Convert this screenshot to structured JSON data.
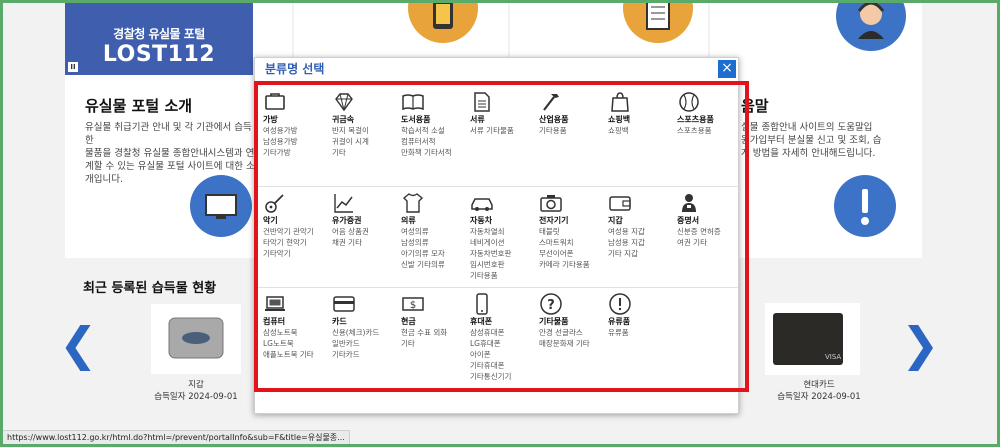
{
  "banner": {
    "line1": "경찰청 유실물 포털",
    "line2": "LOST112",
    "pause": "II"
  },
  "intro": {
    "title": "유실물 포털 소개",
    "text_left": "유실물 취급기관 안내 및 각 기관에서 습득한\n물품을 경찰청 유실물 종합안내시스템과 연\n계할 수 있는 유실물 포털 사이트에 대한 소\n개입니다.",
    "title_right": "움말",
    "text_right": "실물 종합안내 사이트의 도움말입\n원가입부터 분실물 신고 및 조회, 습\n게 방법을 자세히 안내해드립니다."
  },
  "recent": {
    "title": "최근 등록된 습득물 현황",
    "items": [
      {
        "name": "지갑",
        "date": "습득일자 2024-09-01"
      },
      {
        "name": "현대카드",
        "date": "습득일자 2024-09-01"
      }
    ]
  },
  "status_bar": "https://www.lost112.go.kr/html.do?html=/prevent/portalInfo&sub=F&title=유실물종...",
  "dialog": {
    "title": "분류명 선택",
    "close": "×",
    "rows": [
      [
        {
          "icon": "bag-icon",
          "title": "가방",
          "sub": "여성용가방\n남성용가방\n기타가방"
        },
        {
          "icon": "diamond-icon",
          "title": "귀금속",
          "sub": "반지 목걸이\n귀걸이 시계\n기타"
        },
        {
          "icon": "book-icon",
          "title": "도서용품",
          "sub": "학습서적 소설\n컴퓨터서적\n만화책 기타서적"
        },
        {
          "icon": "document-icon",
          "title": "서류",
          "sub": "서류 기타물품"
        },
        {
          "icon": "hammer-icon",
          "title": "산업용품",
          "sub": "기타용품"
        },
        {
          "icon": "shopping-bag-icon",
          "title": "쇼핑백",
          "sub": "쇼핑백"
        },
        {
          "icon": "baseball-icon",
          "title": "스포츠용품",
          "sub": "스포츠용품"
        }
      ],
      [
        {
          "icon": "guitar-icon",
          "title": "악기",
          "sub": "건반악기 관악기\n타악기 현악기\n기타악기"
        },
        {
          "icon": "chart-icon",
          "title": "유가증권",
          "sub": "어음 상품권\n채권 기타"
        },
        {
          "icon": "shirt-icon",
          "title": "의류",
          "sub": "여성의류\n남성의류\n아기의류 모자\n신발 기타의류"
        },
        {
          "icon": "car-icon",
          "title": "자동차",
          "sub": "자동차열쇠\n네비게이션\n자동차번호판\n임시번호판\n기타용품"
        },
        {
          "icon": "camera-icon",
          "title": "전자기기",
          "sub": "태블릿\n스마트워치\n무선이어폰\n카메라 기타용품"
        },
        {
          "icon": "wallet-icon",
          "title": "지갑",
          "sub": "여성용 지갑\n남성용 지갑\n기타 지갑"
        },
        {
          "icon": "person-icon",
          "title": "증명서",
          "sub": "신분증 면허증\n여권 기타"
        }
      ],
      [
        {
          "icon": "laptop-icon",
          "title": "컴퓨터",
          "sub": "삼성노트북\nLG노트북\n애플노트북 기타"
        },
        {
          "icon": "card-icon",
          "title": "카드",
          "sub": "신용(체크)카드\n일반카드\n기타카드"
        },
        {
          "icon": "cash-icon",
          "title": "현금",
          "sub": "현금 수표 외화\n기타"
        },
        {
          "icon": "phone-icon",
          "title": "휴대폰",
          "sub": "삼성휴대폰\nLG휴대폰\n아이폰\n기타휴대폰\n기타통신기기"
        },
        {
          "icon": "question-icon",
          "title": "기타물품",
          "sub": "안경 선글라스\n매장문화재 기타"
        },
        {
          "icon": "exclamation-icon",
          "title": "유류품",
          "sub": "유류품"
        }
      ]
    ]
  },
  "colors": {
    "accent": "#1e6ed0",
    "highlight": "#e2141b",
    "brand": "#3f5fae"
  }
}
